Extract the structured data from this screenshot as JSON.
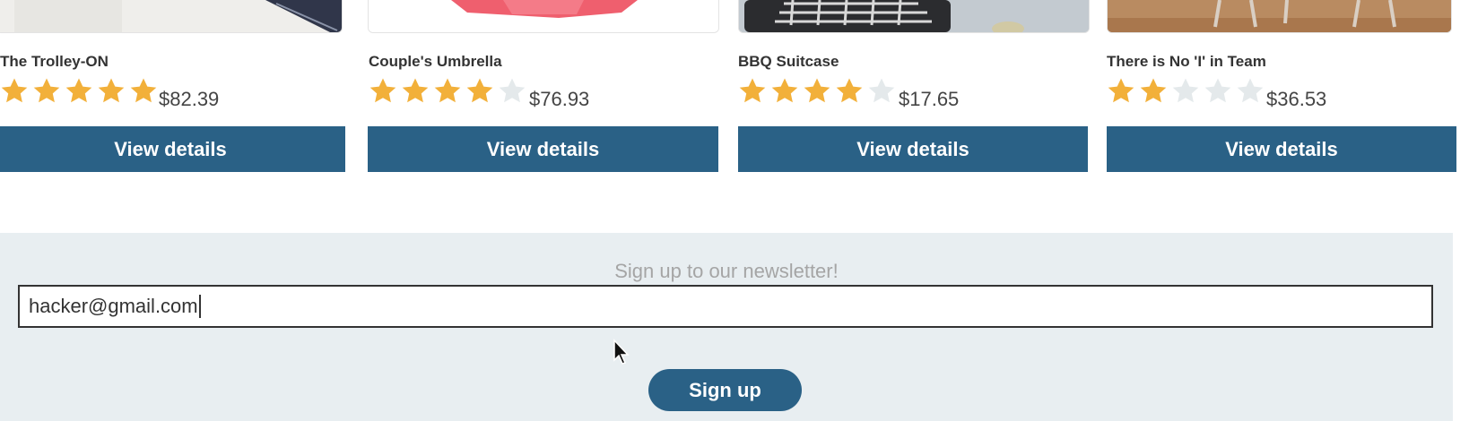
{
  "products": [
    {
      "name": "The Trolley-ON",
      "rating": 5,
      "max_rating": 5,
      "price": "$82.39",
      "button_label": "View details",
      "thumb_icon": "trolley-image"
    },
    {
      "name": "Couple's Umbrella",
      "rating": 4,
      "max_rating": 5,
      "price": "$76.93",
      "button_label": "View details",
      "thumb_icon": "umbrella-image"
    },
    {
      "name": "BBQ Suitcase",
      "rating": 4,
      "max_rating": 5,
      "price": "$17.65",
      "button_label": "View details",
      "thumb_icon": "bbq-suitcase-image"
    },
    {
      "name": "There is No 'I' in Team",
      "rating": 2,
      "max_rating": 5,
      "price": "$36.53",
      "button_label": "View details",
      "thumb_icon": "team-chairs-image"
    }
  ],
  "newsletter": {
    "title": "Sign up to our newsletter!",
    "email_value": "hacker@gmail.com",
    "submit_label": "Sign up"
  },
  "colors": {
    "primary": "#2a6186",
    "star_filled": "#f2b03a",
    "star_empty": "#e4e9eb",
    "newsletter_bg": "#e8eef1"
  }
}
